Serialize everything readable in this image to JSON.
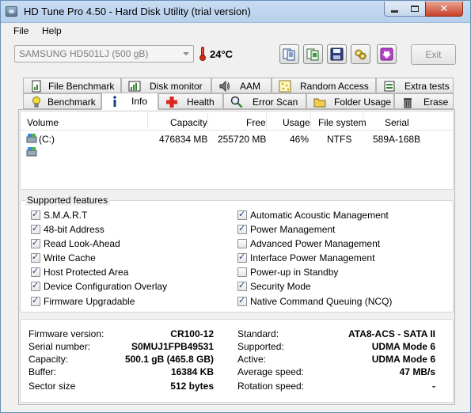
{
  "window": {
    "title": "HD Tune Pro 4.50 - Hard Disk Utility (trial version)",
    "close_glyph": "✕"
  },
  "menu": {
    "file": "File",
    "help": "Help"
  },
  "toolbar": {
    "drive": "SAMSUNG HD501LJ (500 gB)",
    "temperature": "24°C",
    "exit_label": "Exit",
    "buttons": [
      "copy-icon",
      "copy-info-icon",
      "save-icon",
      "options-icon",
      "download-icon"
    ]
  },
  "tabs": {
    "row1": [
      "File Benchmark",
      "Disk monitor",
      "AAM",
      "Random Access",
      "Extra tests"
    ],
    "row2": [
      "Benchmark",
      "Info",
      "Health",
      "Error Scan",
      "Folder Usage",
      "Erase"
    ],
    "active": "Info"
  },
  "volumes": {
    "headers": [
      "Volume",
      "Capacity",
      "Free",
      "Usage",
      "File system",
      "Serial"
    ],
    "rows": [
      {
        "volume": "(C:)",
        "capacity": "476834 MB",
        "free": "255720 MB",
        "usage": "46%",
        "filesystem": "NTFS",
        "serial": "589A-168B"
      },
      {
        "volume": "",
        "capacity": "",
        "free": "",
        "usage": "",
        "filesystem": "",
        "serial": ""
      }
    ]
  },
  "features": {
    "label": "Supported features",
    "check_glyph": "✓",
    "left": [
      {
        "label": "S.M.A.R.T",
        "checked": true
      },
      {
        "label": "48-bit Address",
        "checked": true
      },
      {
        "label": "Read Look-Ahead",
        "checked": true
      },
      {
        "label": "Write Cache",
        "checked": true
      },
      {
        "label": "Host Protected Area",
        "checked": true
      },
      {
        "label": "Device Configuration Overlay",
        "checked": true
      },
      {
        "label": "Firmware Upgradable",
        "checked": true
      }
    ],
    "right": [
      {
        "label": "Automatic Acoustic Management",
        "checked": true
      },
      {
        "label": "Power Management",
        "checked": true
      },
      {
        "label": "Advanced Power Management",
        "checked": false
      },
      {
        "label": "Interface Power Management",
        "checked": true
      },
      {
        "label": "Power-up in Standby",
        "checked": false
      },
      {
        "label": "Security Mode",
        "checked": true
      },
      {
        "label": "Native Command Queuing (NCQ)",
        "checked": true
      }
    ]
  },
  "info": {
    "left": [
      {
        "key": "Firmware version:",
        "value": "CR100-12"
      },
      {
        "key": "Serial number:",
        "value": "S0MUJ1FPB49531"
      },
      {
        "key": "Capacity:",
        "value": "500.1 gB (465.8 GB)"
      },
      {
        "key": "Buffer:",
        "value": "16384 KB"
      },
      {
        "key": "Sector size",
        "value": "512 bytes"
      }
    ],
    "right": [
      {
        "key": "Standard:",
        "value": "ATA8-ACS - SATA II"
      },
      {
        "key": "Supported:",
        "value": "UDMA Mode 6"
      },
      {
        "key": "Active:",
        "value": "UDMA Mode 6"
      },
      {
        "key": "Average speed:",
        "value": "47 MB/s"
      },
      {
        "key": "Rotation speed:",
        "value": "-"
      }
    ]
  }
}
